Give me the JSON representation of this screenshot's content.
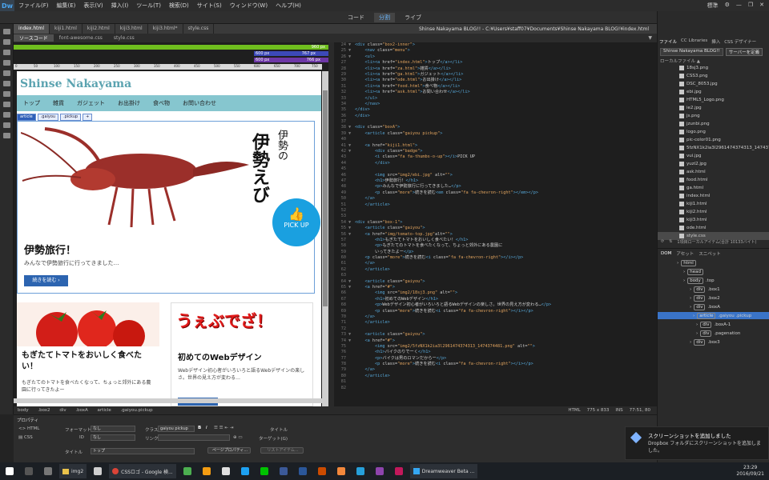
{
  "app": {
    "logo": "Dw",
    "menus": [
      "ファイル(F)",
      "編集(E)",
      "表示(V)",
      "挿入(I)",
      "ツール(T)",
      "検索(D)",
      "サイト(S)",
      "ウィンドウ(W)",
      "ヘルプ(H)"
    ],
    "workspace": "標準",
    "views": [
      "コード",
      "分割",
      "ライブ"
    ],
    "active_view": "分割"
  },
  "doc_tabs": [
    "index.html",
    "kiji1.html",
    "kiji2.html",
    "kiji3.html",
    "kiji3.html*",
    "style.css"
  ],
  "doc_path": "Shinse Nakayama BLOG!! - C:¥Users¥staff07¥Documents¥Shinse Nakayama BLOG!¥index.html",
  "related_files": [
    "ソースコード",
    "font-awesome.css",
    "style.css"
  ],
  "media_queries": [
    {
      "label": "960 px"
    },
    {
      "label": "767 px"
    },
    {
      "label": "600 px"
    },
    {
      "label": "766 px"
    }
  ],
  "ruler_ticks": [
    "0",
    "50",
    "100",
    "150",
    "200",
    "250",
    "300",
    "350",
    "400",
    "450",
    "500",
    "550",
    "600",
    "650",
    "700",
    "750"
  ],
  "site": {
    "title": "Shinse Nakayama",
    "nav": [
      "トップ",
      "雑貨",
      "ガジェット",
      "お出掛け",
      "食べ物",
      "お問い合わせ"
    ],
    "tag_selector": [
      "article",
      ".gaiyou",
      ".pickup",
      "+"
    ],
    "feature": {
      "kanji_small": "伊勢の",
      "kanji_big": "伊勢えび",
      "badge": "PICK UP",
      "title": "伊勢旅行！",
      "text": "みんなで伊勢旅行に行ってきました…",
      "more": "続きを読む"
    },
    "card_left": {
      "title": "もぎたてトマトをおいしく食べたい！",
      "text": "もぎたてのトマトを食べたくなって、ちょっと郊外にある農園に行ってきたよー"
    },
    "card_right": {
      "logo": "うぇぶでざ！",
      "title": "初めてのWebデザイン",
      "text": "Webデザイン初心者がいろいろと語るWebデザインの楽しさ。世界の見え方が変わる…"
    }
  },
  "code_lines": [
    {
      "n": "24",
      "f": "▼",
      "h": "<div class=\"box2-inner\">"
    },
    {
      "n": "25",
      "f": "▼",
      "h": "    <nav class=\"menu\">"
    },
    {
      "n": "26",
      "f": "▼",
      "h": "    <ul>"
    },
    {
      "n": "27",
      "f": "",
      "h": "    <li><a href=\"index.html\">トップ</a></li>"
    },
    {
      "n": "28",
      "f": "",
      "h": "    <li><a href=\"za.html\">雑貨</a></li>"
    },
    {
      "n": "29",
      "f": "",
      "h": "    <li><a href=\"ga.html\">ガジェット</a></li>"
    },
    {
      "n": "30",
      "f": "",
      "h": "    <li><a href=\"ode.html\">お出掛け</a></li>"
    },
    {
      "n": "31",
      "f": "",
      "h": "    <li><a href=\"food.html\">食べ物</a></li>"
    },
    {
      "n": "32",
      "f": "",
      "h": "    <li><a href=\"ask.html\">お問い合わせ</a></li>"
    },
    {
      "n": "33",
      "f": "",
      "h": "    </ul>"
    },
    {
      "n": "34",
      "f": "",
      "h": "    </nav>"
    },
    {
      "n": "35",
      "f": "",
      "h": "</div>"
    },
    {
      "n": "36",
      "f": "",
      "h": "</div>"
    },
    {
      "n": "37",
      "f": "",
      "h": ""
    },
    {
      "n": "38",
      "f": "▼",
      "h": "<div class=\"boxA\">"
    },
    {
      "n": "39",
      "f": "▼",
      "h": "    <article class=\"gaiyou pickup\">"
    },
    {
      "n": "40",
      "f": "",
      "h": ""
    },
    {
      "n": "41",
      "f": "▼",
      "h": "    <a href=\"kiji1.html\">"
    },
    {
      "n": "42",
      "f": "▼",
      "h": "        <div class=\"badge\">"
    },
    {
      "n": "43",
      "f": "",
      "h": "        <i class=\"fa fa-thumbs-o-up\"></i>PICK UP"
    },
    {
      "n": "44",
      "f": "",
      "h": "        </div>"
    },
    {
      "n": "45",
      "f": "",
      "h": ""
    },
    {
      "n": "46",
      "f": "",
      "h": "        <img src=\"img2/ebi.jpg\" alt=\"\">"
    },
    {
      "n": "47",
      "f": "",
      "h": "        <h1>伊勢旅行！</h1>"
    },
    {
      "n": "48",
      "f": "",
      "h": "        <p>みんなで伊勢旅行に行ってきました…</p>"
    },
    {
      "n": "49",
      "f": "",
      "h": "        <p class=\"more\">続きを読む<em class=\"fa fa-chevron-right\"></em></p>"
    },
    {
      "n": "50",
      "f": "",
      "h": "    </a>"
    },
    {
      "n": "51",
      "f": "",
      "h": "    </article>"
    },
    {
      "n": "52",
      "f": "",
      "h": ""
    },
    {
      "n": "53",
      "f": "",
      "h": ""
    },
    {
      "n": "54",
      "f": "▼",
      "h": "<div class=\"box-1\">"
    },
    {
      "n": "55",
      "f": "▼",
      "h": "    <article class=\"gaiyou\">"
    },
    {
      "n": "56",
      "f": "▼",
      "h": "    <a href=\"img/tomato-top.jpg\"alt=\"\">"
    },
    {
      "n": "57",
      "f": "",
      "h": "        <h1>もぎたてトマトをおいしく食べたい！</h1>"
    },
    {
      "n": "58",
      "f": "",
      "h": "        <p>もぎたてのトマトを食べたくなって、ちょっと郊外にある農園に"
    },
    {
      "n": "59",
      "f": "",
      "h": "        いってきたよー</p>"
    },
    {
      "n": "60",
      "f": "",
      "h": "    <p class=\"more\">続きを読む<i class=\"fa fa-chevron-right\"></i></p>"
    },
    {
      "n": "61",
      "f": "",
      "h": "    </a>"
    },
    {
      "n": "62",
      "f": "",
      "h": "    </article>"
    },
    {
      "n": "63",
      "f": "",
      "h": ""
    },
    {
      "n": "64",
      "f": "▼",
      "h": "    <article class=\"gaiyou\">"
    },
    {
      "n": "65",
      "f": "▼",
      "h": "    <a href=\"#\">"
    },
    {
      "n": "66",
      "f": "",
      "h": "        <img src=\"img2/18sj3.png\" alt=\"\">"
    },
    {
      "n": "67",
      "f": "",
      "h": "        <h1>初めてのWebデザイン</h1>"
    },
    {
      "n": "68",
      "f": "",
      "h": "        <p>Webデザイン初心者がいろいろと語るWebデザインの楽しさ。世界の見え方が変わる…</p>"
    },
    {
      "n": "69",
      "f": "",
      "h": "        <p class=\"more\">続きを読む<i class=\"fa fa-chevron-right\"></i></p>"
    },
    {
      "n": "70",
      "f": "",
      "h": "    </a>"
    },
    {
      "n": "71",
      "f": "",
      "h": "    </article>"
    },
    {
      "n": "72",
      "f": "",
      "h": ""
    },
    {
      "n": "73",
      "f": "▼",
      "h": "    <article class=\"gaiyou\">"
    },
    {
      "n": "74",
      "f": "▼",
      "h": "    <a href=\"#\">"
    },
    {
      "n": "75",
      "f": "",
      "h": "        <img src=\"img2/5fzNX1k2ia3l2961474374313_1474374481.png\" alt=\"\">"
    },
    {
      "n": "76",
      "f": "",
      "h": "        <h1>バイクのりでーく</h1>"
    },
    {
      "n": "77",
      "f": "",
      "h": "        <p>バイクは男のロマンだからー</p>"
    },
    {
      "n": "78",
      "f": "",
      "h": "        <p class=\"more\">続きを読む<i class=\"fa fa-chevron-right\"></i></p>"
    },
    {
      "n": "79",
      "f": "",
      "h": "    </a>"
    },
    {
      "n": "80",
      "f": "",
      "h": "    </article>"
    },
    {
      "n": "81",
      "f": "",
      "h": ""
    },
    {
      "n": "82",
      "f": "",
      "h": ""
    }
  ],
  "status": {
    "crumbs": [
      "body",
      ".box2",
      "div",
      ".boxA",
      "article",
      ".gaiyou.pickup"
    ],
    "lang": "HTML",
    "size": "775 x 833",
    "mode": "INS",
    "pos": "77:51, 80"
  },
  "properties": {
    "title": "プロパティ",
    "html": "HTML",
    "css": "CSS",
    "format_label": "フォーマット",
    "format_value": "なし",
    "id_label": "ID",
    "id_value": "なし",
    "class_label": "クラス",
    "class_value": "gaiyou pickup",
    "link_label": "リンク",
    "title_label": "タイトル",
    "target_label": "ターゲット(G)",
    "doc_title_label": "タイトル",
    "doc_title_value": "トップ",
    "page_props": "ページプロパティ...",
    "list_item": "リストアイテム..."
  },
  "right": {
    "tabs": [
      "ファイル",
      "CC Libraries",
      "挿入",
      "CSS デザイナー"
    ],
    "site_name": "Shinse Nakayama BLOG!!",
    "site_btn": "サーバーを定義",
    "local_files": "ローカルファイル ▲",
    "files": [
      "18sj3.png",
      "CSS3.png",
      "DSC_8053.jpg",
      "ebi.jpg",
      "HTML5_Logo.png",
      "ie2.jpg",
      "js.png",
      "jzunbi.png",
      "logo.png",
      "pic-color01.png",
      "5fzNX1k2ia3l2961474374313_1474374481.png",
      "vui.jpg",
      "yuzi2.jpg",
      "ask.html",
      "food.html",
      "ga.html",
      "index.html",
      "kiji1.html",
      "kiji2.html",
      "kiji3.html",
      "ode.html",
      "style.css",
      "za.html"
    ],
    "footer_text": "1項目ローカルアイテム(合計 10133バイト)",
    "dom_tabs": [
      "DOM",
      "アセット",
      "スニペット"
    ],
    "dom_nodes": [
      {
        "tag": "html",
        "cls": ""
      },
      {
        "tag": "head",
        "cls": ""
      },
      {
        "tag": "body",
        "cls": ".top"
      },
      {
        "tag": "div",
        "cls": ".box1"
      },
      {
        "tag": "div",
        "cls": ".box2"
      },
      {
        "tag": "div",
        "cls": ".boxA"
      },
      {
        "tag": "article",
        "cls": ".gaiyou .pickup"
      },
      {
        "tag": "div",
        "cls": ".boxA-1"
      },
      {
        "tag": "div",
        "cls": ".pagenation"
      },
      {
        "tag": "div",
        "cls": ".box3"
      }
    ]
  },
  "toast": {
    "title": "スクリーンショットを追加しました",
    "body": "Dropbox フォルダにスクリーンショットを追加しました。"
  },
  "taskbar": {
    "tasks": [
      "img2",
      "CSSロゴ - Google 検...",
      "Dreamweaver Beta ..."
    ],
    "time": "23:29",
    "date": "2016/09/21"
  }
}
